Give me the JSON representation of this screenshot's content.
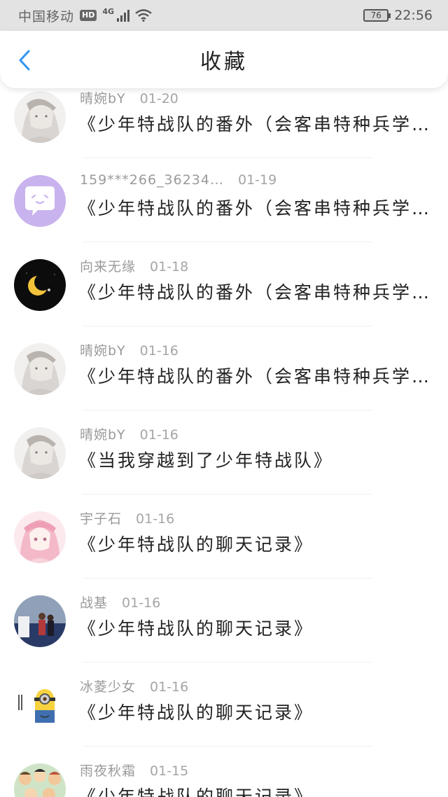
{
  "status_bar": {
    "carrier": "中国移动",
    "hd": "HD",
    "network": "4G",
    "battery": "76",
    "time": "22:56"
  },
  "header": {
    "title": "收藏",
    "back_icon": "chevron-left-icon",
    "accent_color": "#2f95f4"
  },
  "favorites": [
    {
      "username": "晴婉bY",
      "date": "01-20",
      "title": "《少年特战队的番外（会客串特种兵学…",
      "avatar": "anime-girl-gray"
    },
    {
      "username": "159***266_36234…",
      "date": "01-19",
      "title": "《少年特战队的番外（会客串特种兵学…",
      "avatar": "default-chat-bubble"
    },
    {
      "username": "向来无缘",
      "date": "01-18",
      "title": "《少年特战队的番外（会客串特种兵学…",
      "avatar": "moon-night"
    },
    {
      "username": "晴婉bY",
      "date": "01-16",
      "title": "《少年特战队的番外（会客串特种兵学…",
      "avatar": "anime-girl-gray"
    },
    {
      "username": "晴婉bY",
      "date": "01-16",
      "title": "《当我穿越到了少年特战队》",
      "avatar": "anime-girl-gray"
    },
    {
      "username": "宇子石",
      "date": "01-16",
      "title": "《少年特战队的聊天记录》",
      "avatar": "anime-girl-pink"
    },
    {
      "username": "战基",
      "date": "01-16",
      "title": "《少年特战队的聊天记录》",
      "avatar": "photo-people"
    },
    {
      "username": "冰菱少女",
      "date": "01-16",
      "title": "《少年特战队的聊天记录》",
      "avatar": "minion"
    },
    {
      "username": "雨夜秋霜",
      "date": "01-15",
      "title": "《少年特战队的聊天记录》",
      "avatar": "group-cartoon"
    }
  ]
}
